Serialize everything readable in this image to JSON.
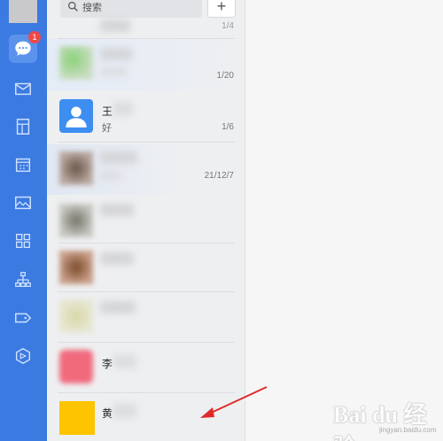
{
  "rail": {
    "unread_badge": "1",
    "items": [
      "chat-icon",
      "mail-icon",
      "document-icon",
      "calendar-icon",
      "album-icon",
      "apps-icon",
      "org-icon",
      "tag-icon",
      "cube-icon"
    ]
  },
  "list": {
    "search_placeholder": "搜索",
    "add_label": "+",
    "rows": [
      {
        "name": "",
        "message": "",
        "date": "1/4"
      },
      {
        "name": "",
        "message": "",
        "date": "1/20"
      },
      {
        "name": "王",
        "message": "好",
        "date": "1/6"
      },
      {
        "name": "",
        "message": "",
        "date": "21/12/7"
      },
      {
        "name": "",
        "message": "",
        "date": ""
      },
      {
        "name": "",
        "message": "",
        "date": ""
      },
      {
        "name": "",
        "message": "",
        "date": ""
      },
      {
        "name": "李",
        "message": "",
        "date": ""
      },
      {
        "name": "黄",
        "message": "",
        "date": ""
      }
    ]
  },
  "watermark": {
    "logo": "Bai du 经验",
    "url": "jingyan.baidu.com"
  },
  "colors": {
    "rail": "#3b7ae0",
    "badge": "#f04848",
    "arrow": "#e02a2a",
    "yellow_avatar": "#ffc400",
    "blue_avatar": "#3d8ef0"
  }
}
